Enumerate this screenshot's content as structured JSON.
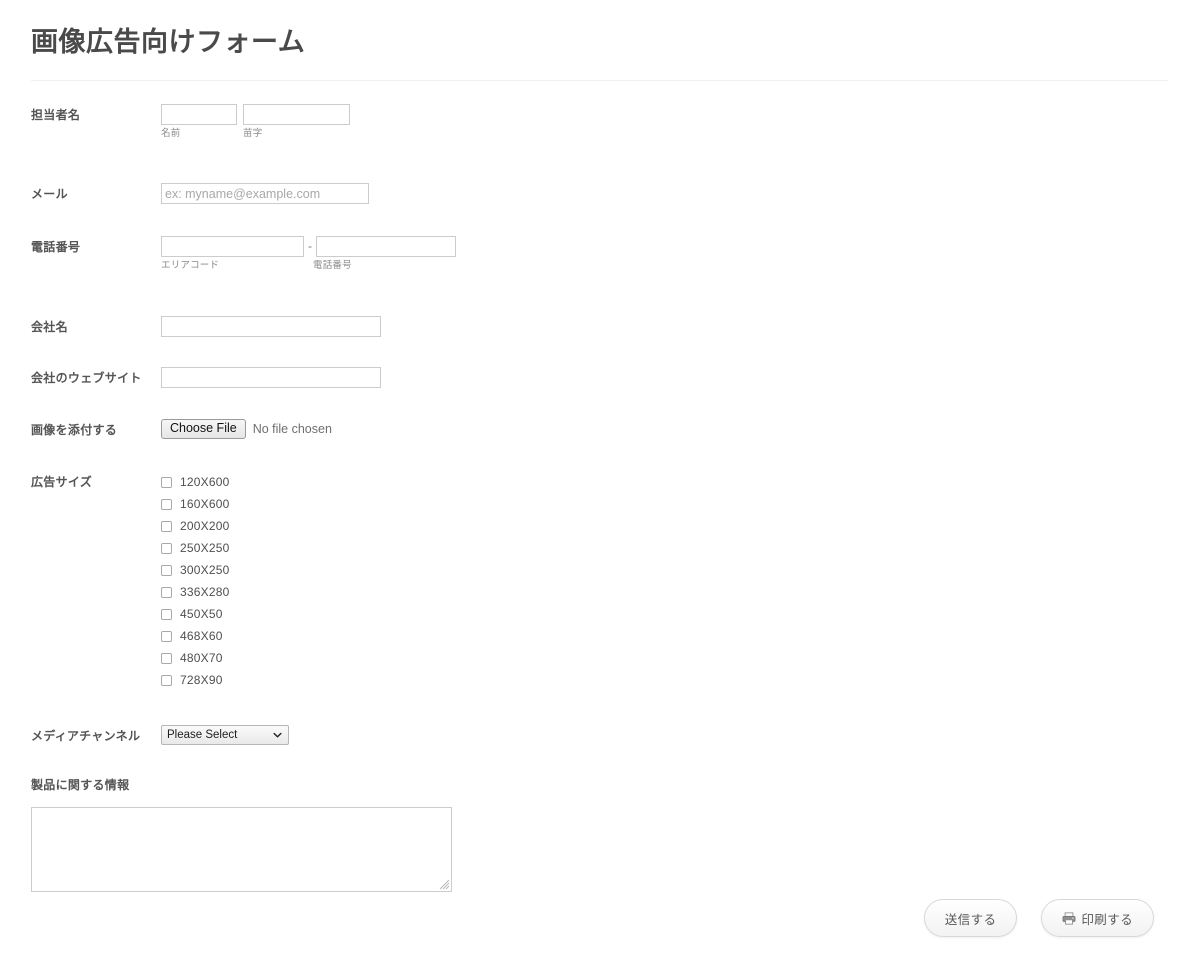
{
  "header": {
    "title": "画像広告向けフォーム"
  },
  "fields": {
    "person_name": {
      "label": "担当者名",
      "first": {
        "value": "",
        "placeholder": "",
        "sub_label": "名前"
      },
      "last": {
        "value": "",
        "placeholder": "",
        "sub_label": "苗字"
      }
    },
    "email": {
      "label": "メール",
      "value": "",
      "placeholder": "ex: myname@example.com"
    },
    "phone": {
      "label": "電話番号",
      "separator": "-",
      "area": {
        "value": "",
        "placeholder": "",
        "sub_label": "エリアコード"
      },
      "number": {
        "value": "",
        "placeholder": "",
        "sub_label": "電話番号"
      }
    },
    "company": {
      "label": "会社名",
      "value": "",
      "placeholder": ""
    },
    "website": {
      "label": "会社のウェブサイト",
      "value": "",
      "placeholder": ""
    },
    "attachment": {
      "label": "画像を添付する",
      "button_label": "Choose File",
      "status_text": "No file chosen"
    },
    "ad_size": {
      "label": "広告サイズ",
      "options": [
        {
          "label": "120X600",
          "checked": false
        },
        {
          "label": "160X600",
          "checked": false
        },
        {
          "label": "200X200",
          "checked": false
        },
        {
          "label": "250X250",
          "checked": false
        },
        {
          "label": "300X250",
          "checked": false
        },
        {
          "label": "336X280",
          "checked": false
        },
        {
          "label": "450X50",
          "checked": false
        },
        {
          "label": "468X60",
          "checked": false
        },
        {
          "label": "480X70",
          "checked": false
        },
        {
          "label": "728X90",
          "checked": false
        }
      ]
    },
    "media_channel": {
      "label": "メディアチャンネル",
      "selected": "Please Select",
      "options": [
        "Please Select"
      ],
      "chevron_icon": "chevron-down-icon"
    },
    "product_info": {
      "label": "製品に関する情報",
      "value": "",
      "placeholder": ""
    }
  },
  "footer": {
    "submit_label": "送信する",
    "print_label": "印刷する",
    "print_icon": "printer-icon"
  },
  "colors": {
    "title": "#4a4a4a",
    "label": "#555555",
    "sub_label": "#8a8a8a",
    "input_border": "#ccccd0",
    "rule": "#f0f0f1",
    "button_text": "#575757"
  }
}
